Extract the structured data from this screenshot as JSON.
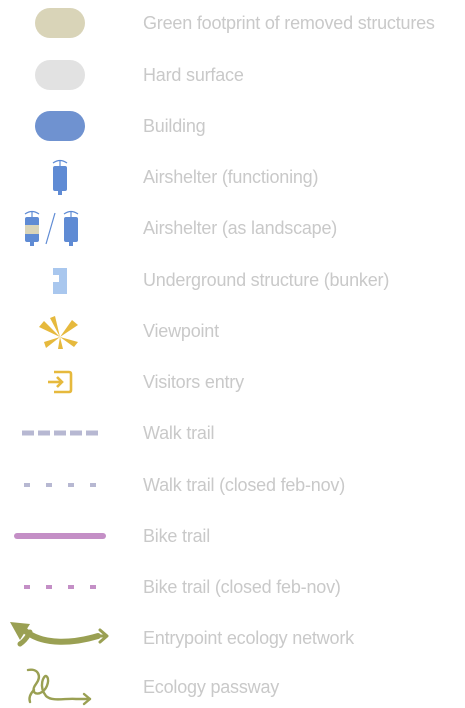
{
  "colors": {
    "label": "#c9c9c9",
    "green_footprint": "#d9d4b8",
    "hard_surface": "#e2e2e2",
    "building": "#6f92d0",
    "airshelter": "#5f8bd4",
    "bunker": "#a9c7ee",
    "viewpoint": "#e6b93d",
    "walk_trail": "#b7b8d2",
    "bike_trail": "#c48fc6",
    "ecology": "#9aa053"
  },
  "legend": {
    "items": [
      {
        "icon": "green-footprint-swatch",
        "label": "Green footprint of removed structures"
      },
      {
        "icon": "hard-surface-swatch",
        "label": "Hard surface"
      },
      {
        "icon": "building-swatch",
        "label": "Building"
      },
      {
        "icon": "airshelter-icon",
        "label": "Airshelter (functioning)"
      },
      {
        "icon": "airshelter-landscape-icon",
        "label": "Airshelter (as landscape)"
      },
      {
        "icon": "bunker-icon",
        "label": "Underground structure (bunker)"
      },
      {
        "icon": "viewpoint-icon",
        "label": "Viewpoint"
      },
      {
        "icon": "entry-icon",
        "label": "Visitors entry"
      },
      {
        "icon": "walk-trail-line",
        "label": "Walk trail"
      },
      {
        "icon": "walk-trail-closed-line",
        "label": "Walk trail (closed feb-nov)"
      },
      {
        "icon": "bike-trail-line",
        "label": "Bike trail"
      },
      {
        "icon": "bike-trail-closed-line",
        "label": "Bike trail (closed feb-nov)"
      },
      {
        "icon": "ecology-entry-arrow-icon",
        "label": "Entrypoint ecology network"
      },
      {
        "icon": "ecology-passway-icon",
        "label": "Ecology passway"
      }
    ]
  }
}
